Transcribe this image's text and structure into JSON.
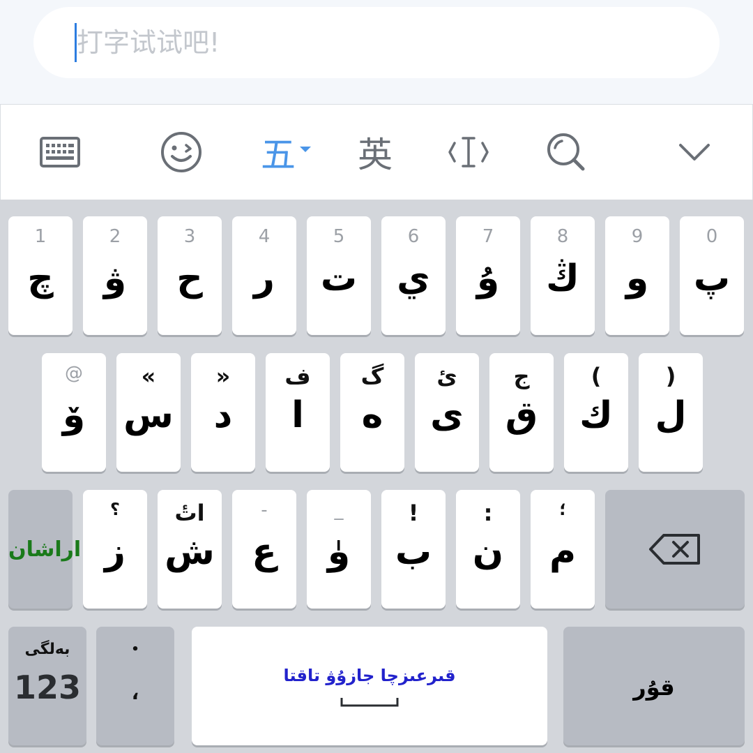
{
  "input": {
    "placeholder": "打字试试吧!"
  },
  "toolbar": {
    "ime_label": "五",
    "english_label": "英"
  },
  "keyboard": {
    "row1": [
      {
        "top": "1",
        "main": "چ"
      },
      {
        "top": "2",
        "main": "ۋ"
      },
      {
        "top": "3",
        "main": "ح"
      },
      {
        "top": "4",
        "main": "ر"
      },
      {
        "top": "5",
        "main": "ت"
      },
      {
        "top": "6",
        "main": "ي"
      },
      {
        "top": "7",
        "main": "ۇ"
      },
      {
        "top": "8",
        "main": "ڭ"
      },
      {
        "top": "9",
        "main": "و"
      },
      {
        "top": "0",
        "main": "پ"
      }
    ],
    "row2": [
      {
        "top": "@",
        "main": "ۆ"
      },
      {
        "top": "«",
        "main": "س"
      },
      {
        "top": "»",
        "main": "د"
      },
      {
        "top": "ف",
        "main": "ا"
      },
      {
        "top": "گ",
        "main": "ە"
      },
      {
        "top": "ئ",
        "main": "ى"
      },
      {
        "top": "ج",
        "main": "ق"
      },
      {
        "top": "(",
        "main": "ك"
      },
      {
        "top": ")",
        "main": "ل"
      }
    ],
    "row3": [
      {
        "top": "؟",
        "main": "ز"
      },
      {
        "top": "اتٔ",
        "main": "ش"
      },
      {
        "top": "-",
        "main": "ع"
      },
      {
        "top": "_",
        "main": "ۈ"
      },
      {
        "top": "!",
        "main": "ب"
      },
      {
        "top": ":",
        "main": "ن"
      },
      {
        "top": "؛",
        "main": "م"
      }
    ],
    "symbol_key_label": "اراشان",
    "numbers_top": "بەلگى",
    "numbers_main": "123",
    "punct_top": "•",
    "punct_main": "،",
    "space_label": "قىرعىزچا جازۇۋ تاقتا",
    "enter_label": "قۇر"
  },
  "colors": {
    "accent": "#4a95e8",
    "symbol_key": "#1a7a1a",
    "space_label": "#2222cc",
    "key_bg": "#ffffff",
    "fn_key_bg": "#b7bbc3",
    "keyboard_bg": "#d3d6db"
  },
  "icons": [
    "keyboard-icon",
    "emoji-icon",
    "ime-dropdown-icon",
    "cursor-icon",
    "search-icon",
    "chevron-down-icon",
    "backspace-icon",
    "space-bar-icon"
  ]
}
